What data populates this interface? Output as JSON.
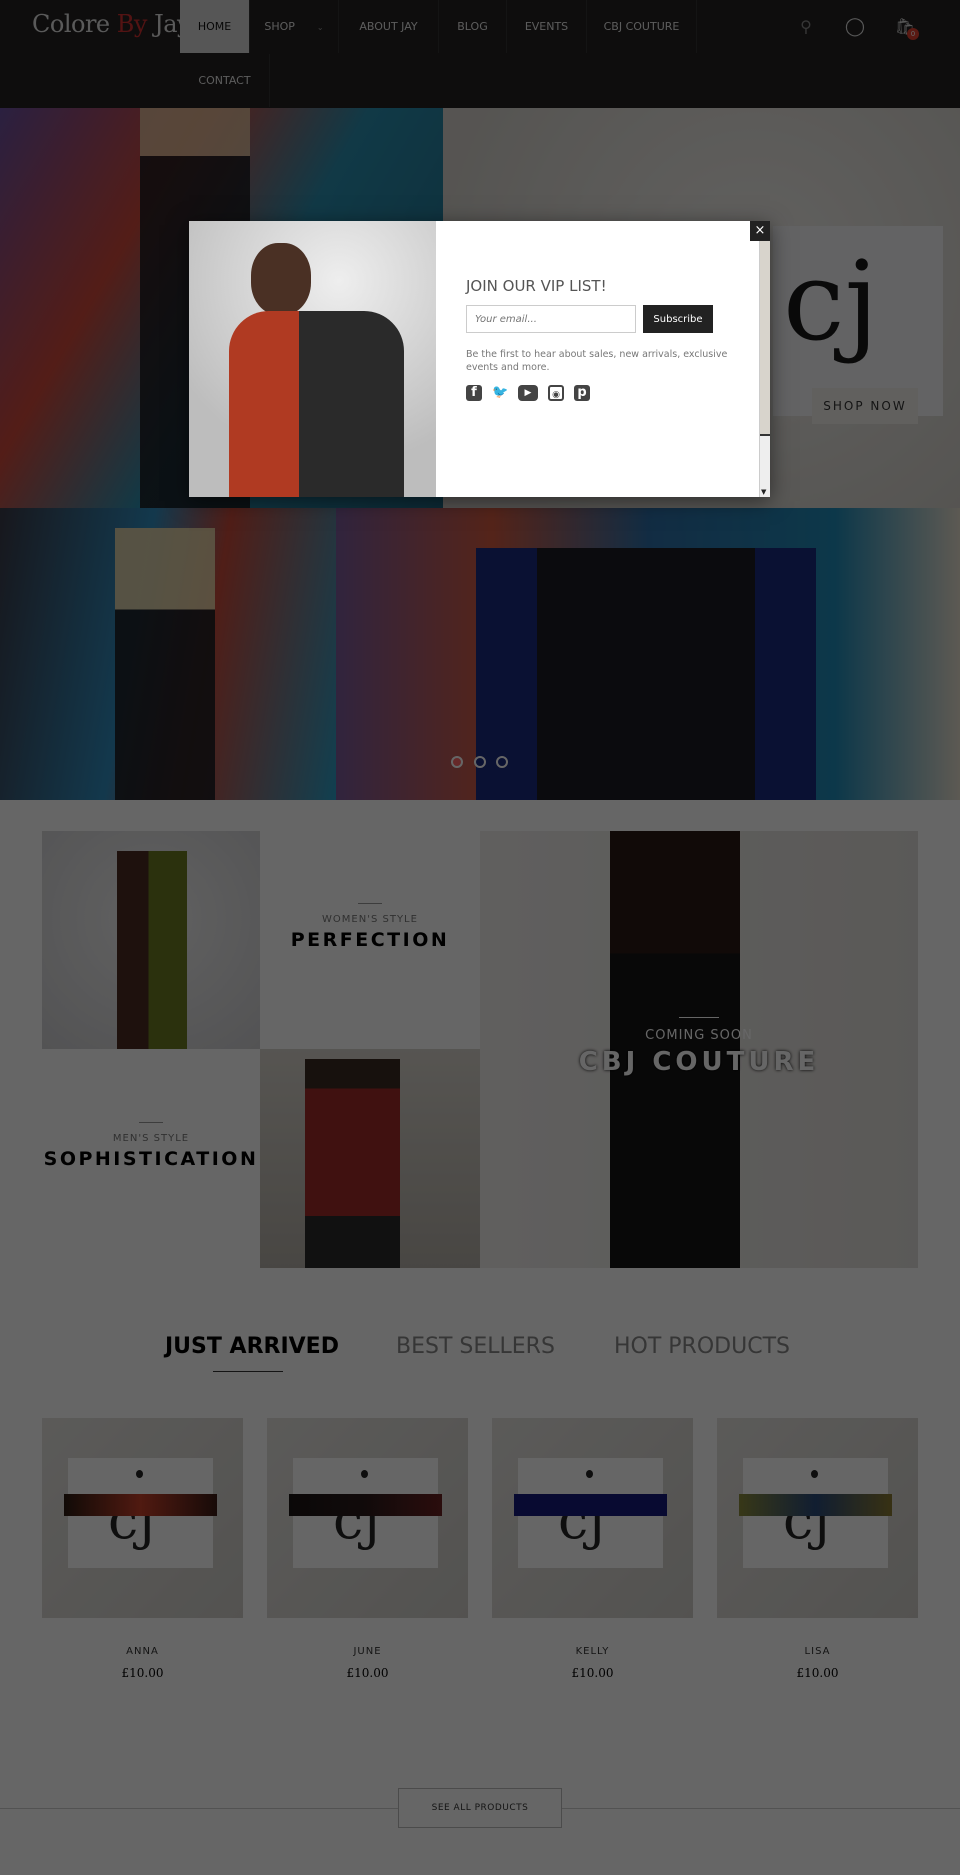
{
  "header": {
    "logo": {
      "part1": "Colore ",
      "part2": "By",
      "part3": " Jay"
    },
    "nav": [
      "HOME",
      "SHOP",
      "ABOUT JAY",
      "BLOG",
      "EVENTS",
      "CBJ COUTURE",
      "CONTACT"
    ],
    "cart_count": "0",
    "icons": [
      "search-icon",
      "user-icon",
      "shopping-bag-icon"
    ]
  },
  "hero": {
    "shop_now": "SHOP NOW",
    "slides": 3,
    "active_slide": 1
  },
  "banners": {
    "women": {
      "subtitle": "WOMEN'S STYLE",
      "title": "PERFECTION"
    },
    "men": {
      "subtitle": "MEN'S STYLE",
      "title": "SOPHISTICATION"
    },
    "couture": {
      "subtitle": "COMING SOON",
      "title": "CBJ COUTURE"
    }
  },
  "tabs": [
    "JUST ARRIVED",
    "BEST SELLERS",
    "HOT PRODUCTS"
  ],
  "products": [
    {
      "name": "ANNA",
      "price": "£10.00"
    },
    {
      "name": "JUNE",
      "price": "£10.00"
    },
    {
      "name": "KELLY",
      "price": "£10.00"
    },
    {
      "name": "LISA",
      "price": "£10.00"
    }
  ],
  "see_all": "SEE ALL PRODUCTS",
  "popup": {
    "title": "JOIN OUR VIP LIST!",
    "email_placeholder": "Your email...",
    "subscribe": "Subscribe",
    "description": "Be the first to hear about sales, new arrivals, exclusive events and more.",
    "close": "×",
    "social": [
      "facebook-icon",
      "twitter-icon",
      "youtube-icon",
      "instagram-icon",
      "pinterest-icon"
    ]
  },
  "colors": {
    "accent": "#b02a2a",
    "header_bg": "#151414",
    "overlay": "rgba(0,0,0,0.64)"
  }
}
